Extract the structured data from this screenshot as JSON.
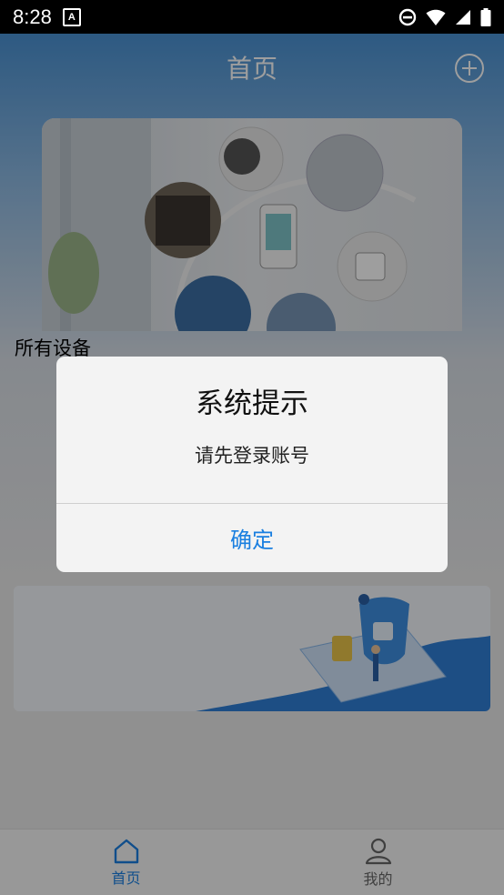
{
  "status_bar": {
    "time": "8:28",
    "app_icon_letter": "A",
    "icons": [
      "do-not-disturb-icon",
      "wifi-icon",
      "signal-icon",
      "battery-icon"
    ]
  },
  "header": {
    "title": "首页",
    "add_icon": "plus-circle-icon"
  },
  "section": {
    "all_devices_label": "所有设备"
  },
  "dialog": {
    "title": "系统提示",
    "message": "请先登录账号",
    "confirm_label": "确定"
  },
  "tabbar": {
    "tabs": [
      {
        "label": "首页",
        "icon": "home-icon",
        "active": true
      },
      {
        "label": "我的",
        "icon": "user-icon",
        "active": false
      }
    ]
  },
  "colors": {
    "accent": "#1a7fe0",
    "header_blue": "#4a91d2"
  }
}
